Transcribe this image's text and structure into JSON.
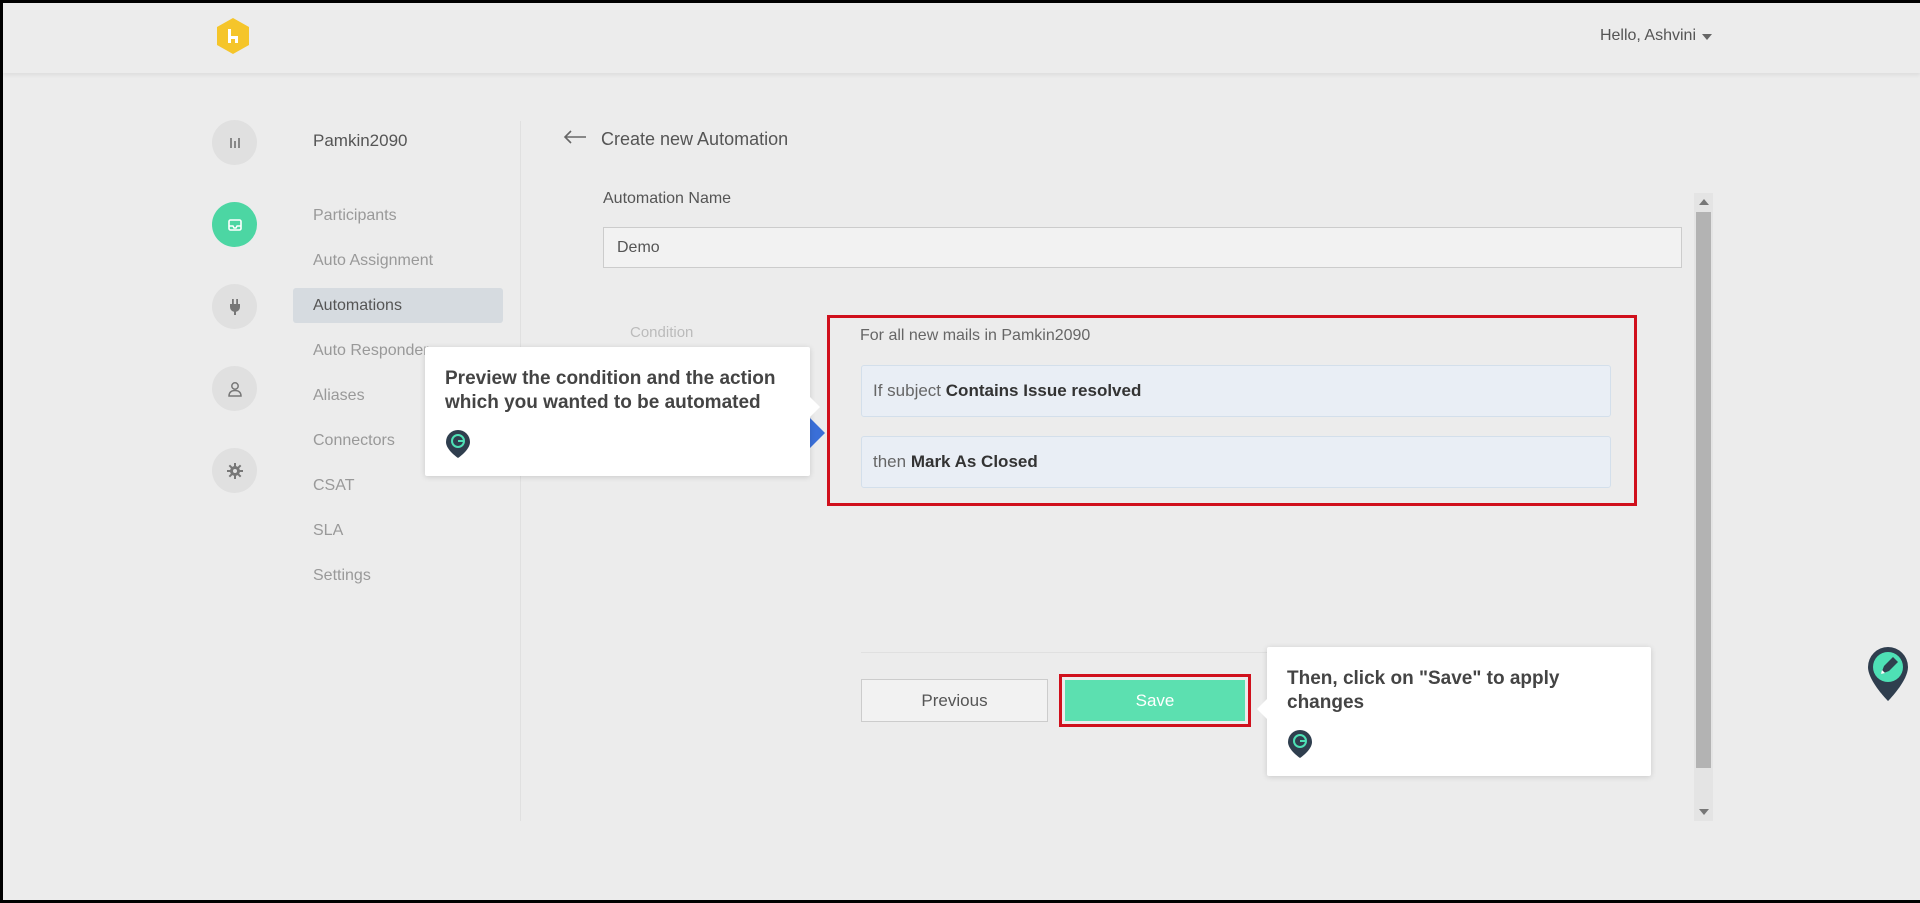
{
  "header": {
    "greeting": "Hello, Ashvini",
    "logo_icon": "hexagon-logo-icon",
    "brand_color": "#f5c52a"
  },
  "sidebar": {
    "workspace_name": "Pamkin2090",
    "rail_icons": [
      "chart-bars-icon",
      "inbox-icon",
      "plug-icon",
      "user-icon",
      "gear-icon"
    ],
    "items": [
      {
        "label": "Participants"
      },
      {
        "label": "Auto Assignment"
      },
      {
        "label": "Automations"
      },
      {
        "label": "Auto Responder"
      },
      {
        "label": "Aliases"
      },
      {
        "label": "Connectors"
      },
      {
        "label": "CSAT"
      },
      {
        "label": "SLA"
      },
      {
        "label": "Settings"
      }
    ]
  },
  "main": {
    "page_title": "Create new Automation",
    "name_label": "Automation Name",
    "name_value": "Demo",
    "condition_label": "Condition",
    "preview": {
      "heading": "For all new mails in Pamkin2090",
      "if_prefix": "If subject",
      "if_rule": "Contains Issue resolved",
      "then_prefix": "then",
      "then_rule": "Mark As Closed"
    },
    "buttons": {
      "previous": "Previous",
      "save": "Save"
    }
  },
  "tooltips": {
    "preview_tip": "Preview the condition and the action which you wanted to be automated",
    "save_tip": "Then, click on \"Save\" to apply changes"
  },
  "colors": {
    "accent": "#4cd6a3",
    "save_button": "#5ce0b0",
    "highlight": "#d0101c"
  }
}
